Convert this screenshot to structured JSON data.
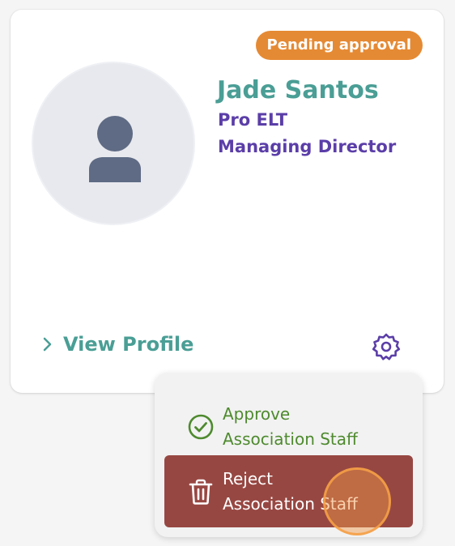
{
  "card": {
    "badge": "Pending approval",
    "name": "Jade Santos",
    "organization": "Pro ELT",
    "role": "Managing Director",
    "view_profile": "View Profile",
    "avatar_icon": "user-icon",
    "settings_icon": "gear-icon"
  },
  "menu": {
    "approve": {
      "line1": "Approve",
      "line2": "Association Staff",
      "icon": "check-circle-icon"
    },
    "reject": {
      "line1": "Reject",
      "line2": "Association Staff",
      "icon": "trash-icon"
    }
  },
  "colors": {
    "badge": "#e58a34",
    "name": "#4a9e95",
    "subtitle": "#5b3ea8",
    "approve": "#4e8a2e",
    "reject_bg": "#974742"
  }
}
